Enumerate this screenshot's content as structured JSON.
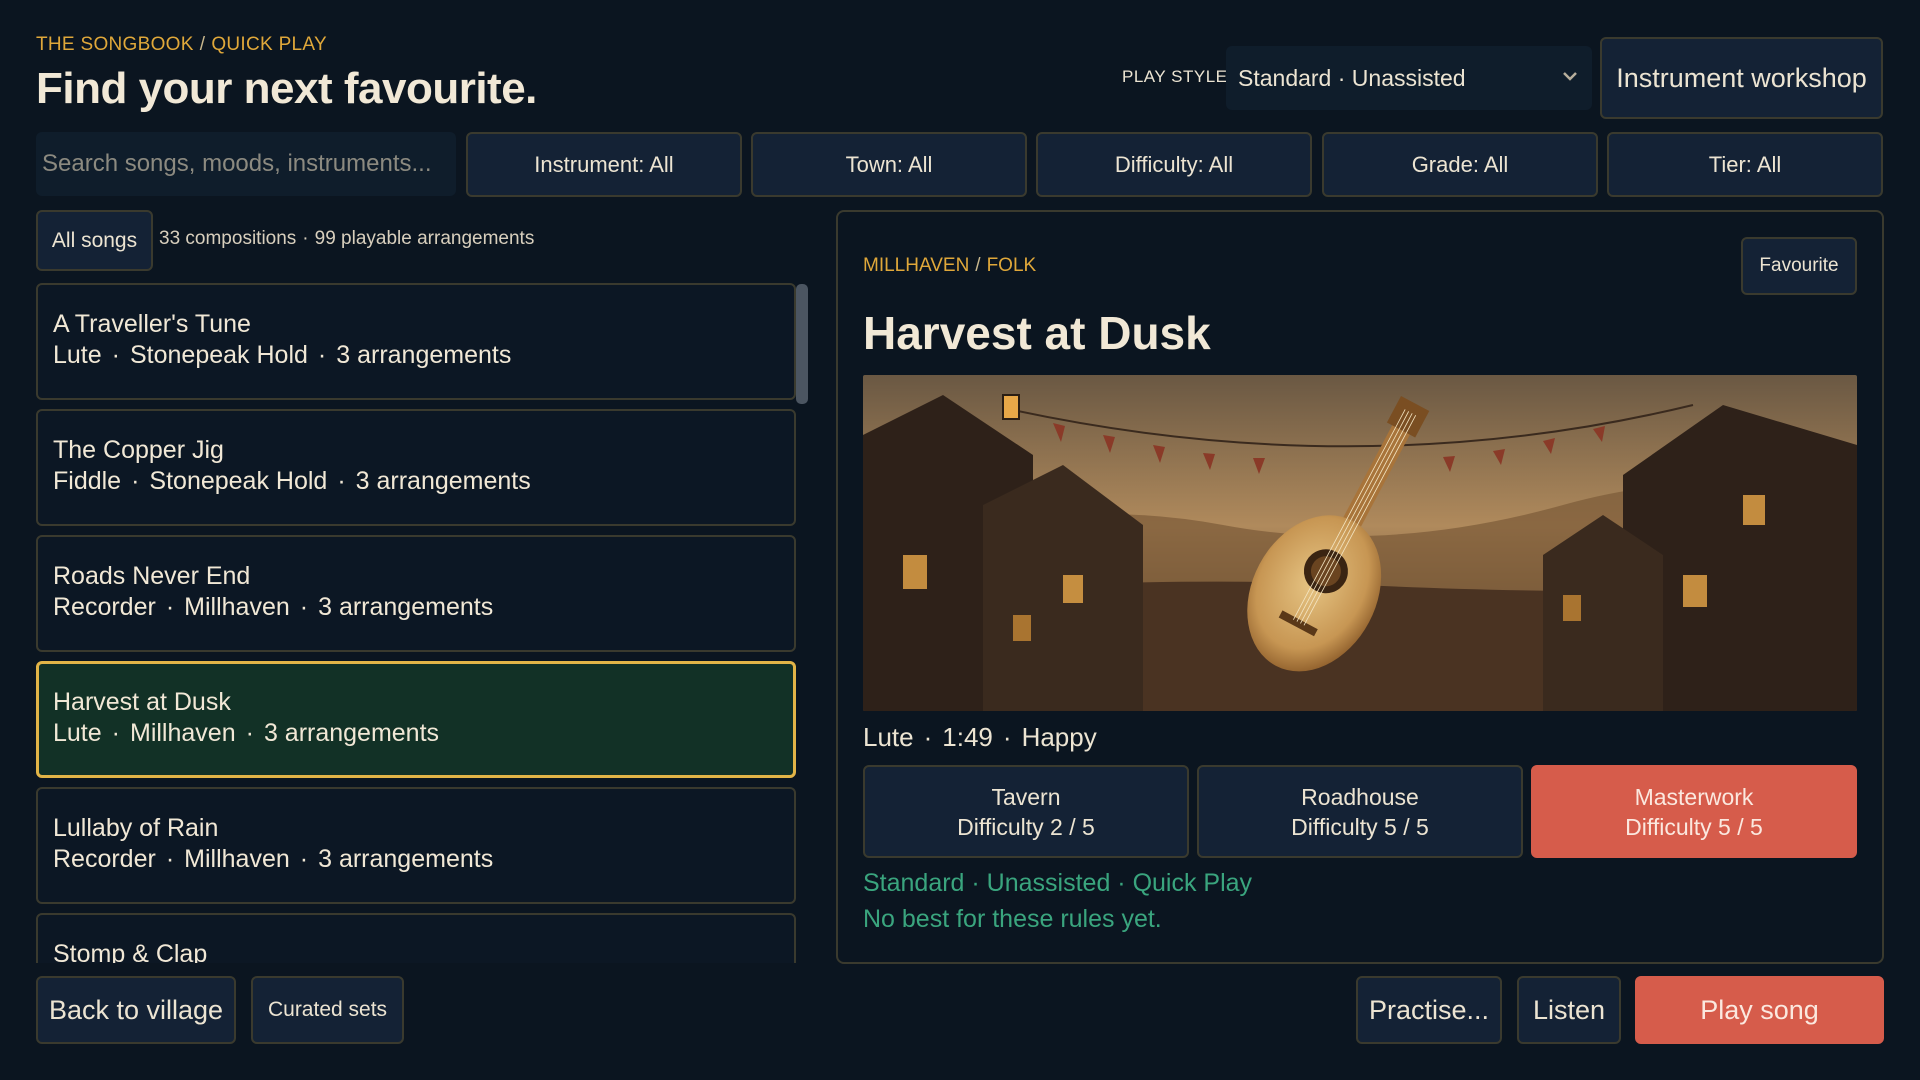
{
  "header": {
    "breadcrumb": [
      "THE SONGBOOK",
      "QUICK PLAY"
    ],
    "breadcrumb_sep": "/",
    "title": "Find your next favourite.",
    "play_style_label": "PLAY STYLE",
    "play_style_value": "Standard · Unassisted",
    "workshop_label": "Instrument workshop"
  },
  "filters": {
    "search_placeholder": "Search songs, moods, instruments...",
    "buttons": [
      "Instrument: All",
      "Town: All",
      "Difficulty: All",
      "Grade: All",
      "Tier: All"
    ]
  },
  "list": {
    "all_songs_label": "All songs",
    "compositions": "33 compositions",
    "arrangements": "99 playable arrangements",
    "songs": [
      {
        "title": "A Traveller's Tune",
        "instrument": "Lute",
        "town": "Stonepeak Hold",
        "arrangements": "3 arrangements"
      },
      {
        "title": "The Copper Jig",
        "instrument": "Fiddle",
        "town": "Stonepeak Hold",
        "arrangements": "3 arrangements"
      },
      {
        "title": "Roads Never End",
        "instrument": "Recorder",
        "town": "Millhaven",
        "arrangements": "3 arrangements"
      },
      {
        "title": "Harvest at Dusk",
        "instrument": "Lute",
        "town": "Millhaven",
        "arrangements": "3 arrangements"
      },
      {
        "title": "Lullaby of Rain",
        "instrument": "Recorder",
        "town": "Millhaven",
        "arrangements": "3 arrangements"
      },
      {
        "title": "Stomp & Clap",
        "instrument": "",
        "town": "",
        "arrangements": ""
      }
    ],
    "selected_index": 3
  },
  "detail": {
    "breadcrumb": [
      "MILLHAVEN",
      "FOLK"
    ],
    "favourite_label": "Favourite",
    "title": "Harvest at Dusk",
    "instrument": "Lute",
    "duration": "1:49",
    "mood": "Happy",
    "arrangement_options": [
      {
        "name": "Tavern",
        "difficulty": "Difficulty 2 / 5",
        "active": false
      },
      {
        "name": "Roadhouse",
        "difficulty": "Difficulty 5 / 5",
        "active": false
      },
      {
        "name": "Masterwork",
        "difficulty": "Difficulty 5 / 5",
        "active": true
      }
    ],
    "rules_text": "Standard · Unassisted · Quick Play",
    "best_text": "No best for these rules yet."
  },
  "footer": {
    "back_label": "Back to village",
    "curated_label": "Curated sets",
    "practise_label": "Practise...",
    "listen_label": "Listen",
    "play_label": "Play song"
  },
  "colors": {
    "background": "#0b1520",
    "accent_gold": "#e0a83a",
    "accent_red": "#d65c4b",
    "success_green": "#3aa57e",
    "selected_bg": "#123126"
  }
}
